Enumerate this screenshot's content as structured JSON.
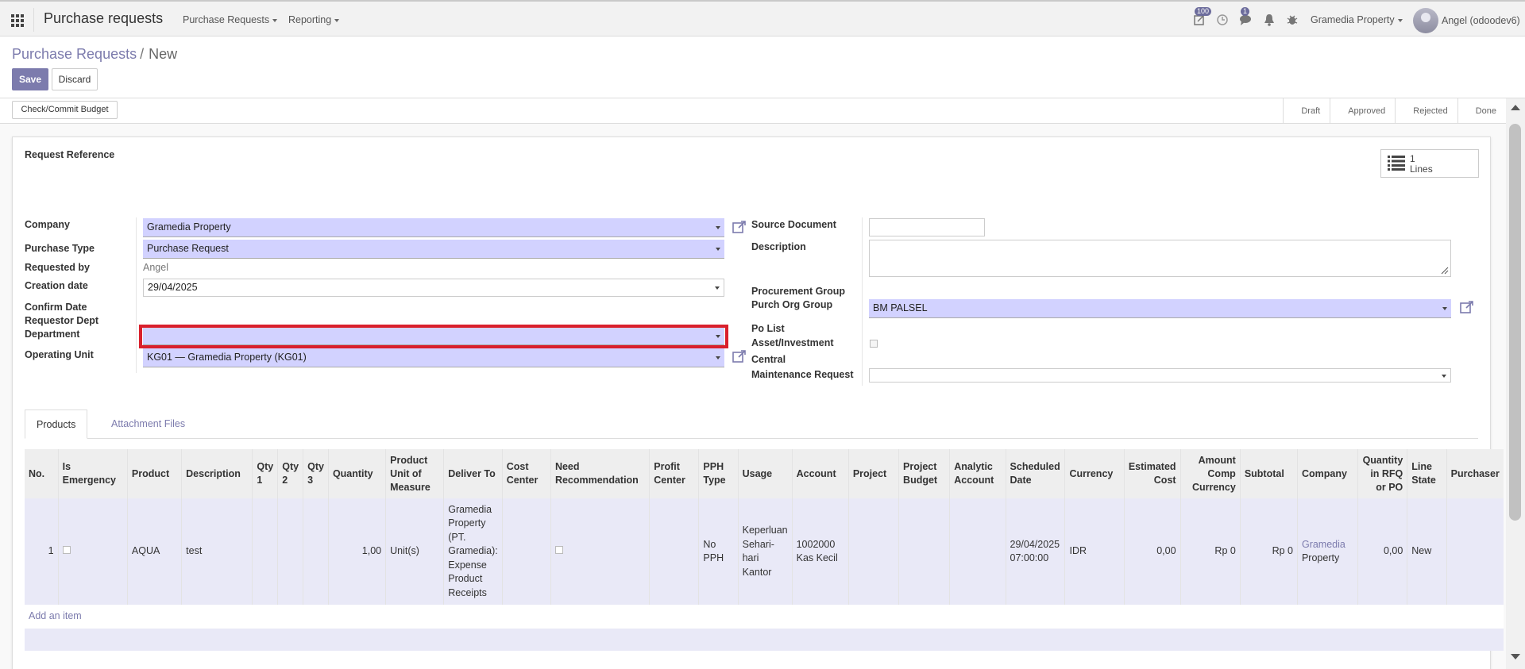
{
  "navbar": {
    "app_title": "Purchase requests",
    "menus": [
      "Purchase Requests",
      "Reporting"
    ],
    "activity_badge": "100",
    "messages_badge": "1",
    "company": "Gramedia Property",
    "user": "Angel (odoodev6)"
  },
  "breadcrumb": {
    "parent": "Purchase Requests",
    "separator": "/",
    "current": "New"
  },
  "buttons": {
    "save": "Save",
    "discard": "Discard",
    "check_budget": "Check/Commit Budget"
  },
  "status_steps": [
    "Draft",
    "Approved",
    "Rejected",
    "Done"
  ],
  "form": {
    "title_label": "Request Reference",
    "smart_button": {
      "count": "1",
      "label": "Lines"
    },
    "left": {
      "company_label": "Company",
      "company_value": "Gramedia Property",
      "purchase_type_label": "Purchase Type",
      "purchase_type_value": "Purchase Request",
      "requested_by_label": "Requested by",
      "requested_by_value": "Angel",
      "creation_date_label": "Creation date",
      "creation_date_value": "29/04/2025",
      "confirm_date_label": "Confirm Date",
      "requestor_dept_label": "Requestor Dept",
      "department_label": "Department",
      "department_value": "",
      "operating_unit_label": "Operating Unit",
      "operating_unit_value": "KG01 — Gramedia Property (KG01)"
    },
    "right": {
      "source_document_label": "Source Document",
      "description_label": "Description",
      "procurement_group_label": "Procurement Group",
      "purch_org_group_label": "Purch Org Group",
      "purch_org_group_value": "BM PALSEL",
      "po_list_label": "Po List",
      "asset_investment_label": "Asset/Investment",
      "central_label": "Central",
      "maintenance_request_label": "Maintenance Request"
    }
  },
  "tabs": [
    "Products",
    "Attachment Files"
  ],
  "table": {
    "headers": [
      "No.",
      "Is Emergency",
      "Product",
      "Description",
      "Qty 1",
      "Qty 2",
      "Qty 3",
      "Quantity",
      "Product Unit of Measure",
      "Deliver To",
      "Cost Center",
      "Need Recommendation",
      "Profit Center",
      "PPH Type",
      "Usage",
      "Account",
      "Project",
      "Project Budget",
      "Analytic Account",
      "Scheduled Date",
      "Currency",
      "Estimated Cost",
      "Amount Comp Currency",
      "Subtotal",
      "Company",
      "Quantity in RFQ or PO",
      "Line State",
      "Purchaser"
    ],
    "row": {
      "no": "1",
      "product": "AQUA",
      "description": "test",
      "quantity": "1,00",
      "uom": "Unit(s)",
      "deliver_to": "Gramedia Property (PT. Gramedia): Expense Product Receipts",
      "pph_type": "No PPH",
      "usage": "Keperluan Sehari-hari Kantor",
      "account": "1002000 Kas Kecil",
      "scheduled_date": "29/04/2025 07:00:00",
      "currency": "IDR",
      "estimated_cost": "0,00",
      "amount_comp_currency": "Rp 0",
      "subtotal": "Rp 0",
      "company_link": "Gramedia",
      "company_rest": "Property",
      "qty_rfq": "0,00",
      "line_state": "New"
    },
    "add_item": "Add an item"
  }
}
